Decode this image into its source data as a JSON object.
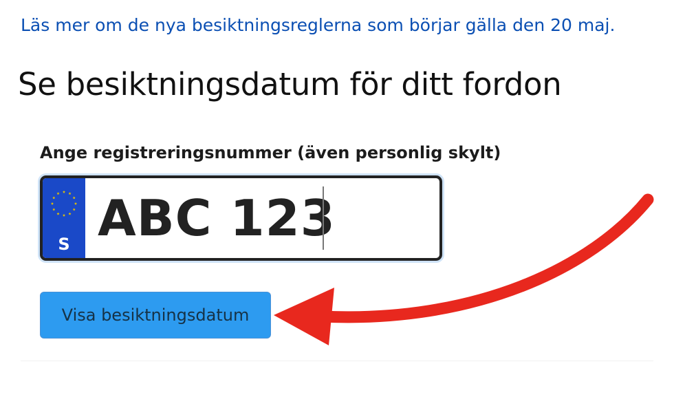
{
  "info_link": {
    "text": "Läs mer om de nya besiktningsreglerna som börjar gälla den 20 maj."
  },
  "page_title": "Se besiktningsdatum för ditt fordon",
  "form": {
    "label": "Ange registreringsnummer (även personlig skylt)",
    "plate": {
      "country_code": "S",
      "value": "ABC 123"
    },
    "submit_label": "Visa besiktningsdatum"
  },
  "colors": {
    "link": "#0b4fb3",
    "eu_band": "#1a49c8",
    "eu_stars": "#e6c200",
    "button": "#2d9bf0",
    "arrow": "#e8281e"
  },
  "icons": {
    "eu_stars": "eu-stars-icon",
    "arrow": "red-arrow-annotation"
  }
}
